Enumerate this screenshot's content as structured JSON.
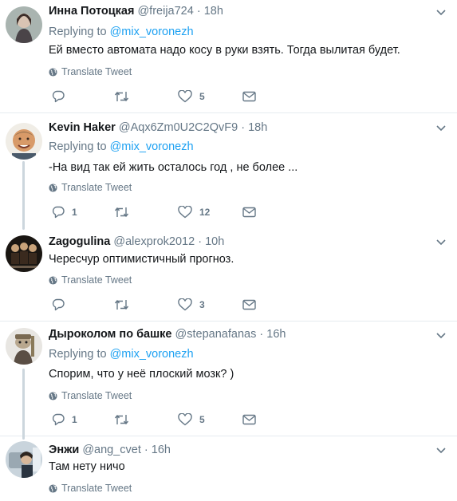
{
  "translate_label": "Translate Tweet",
  "replying_prefix": "Replying to",
  "colors": {
    "link": "#1da1f2",
    "muted": "#657786",
    "text": "#14171a",
    "divider": "#e6ecf0",
    "thread": "#ccd6dd"
  },
  "icons": {
    "reply": "reply-icon",
    "retweet": "retweet-icon",
    "like": "heart-icon",
    "dm": "envelope-icon",
    "more": "chevron-down-icon",
    "translate": "globe-icon"
  },
  "tweets": [
    {
      "name": "Инна Потоцкая",
      "handle": "@freija724",
      "time": "18h",
      "reply_to": "@mix_voronezh",
      "text": "Ей вместо автомата надо косу в руки взять. Тогда вылитая будет.",
      "replies": "",
      "retweets": "",
      "likes": "5"
    },
    {
      "name": "Kevin Haker",
      "handle": "@Aqx6Zm0U2C2QvF9",
      "time": "18h",
      "reply_to": "@mix_voronezh",
      "text": "-На вид так ей жить осталось год , не более ...",
      "replies": "1",
      "retweets": "",
      "likes": "12"
    },
    {
      "name": "Zagogulina",
      "handle": "@alexprok2012",
      "time": "10h",
      "reply_to": "",
      "text": "Чересчур оптимистичный прогноз.",
      "replies": "",
      "retweets": "",
      "likes": "3"
    },
    {
      "name": "Дыроколом по башке",
      "handle": "@stepanafanas",
      "time": "16h",
      "reply_to": "@mix_voronezh",
      "text": "Спорим, что у неё плоский мозк? )",
      "replies": "1",
      "retweets": "",
      "likes": "5"
    },
    {
      "name": "Энжи",
      "handle": "@ang_cvet",
      "time": "16h",
      "reply_to": "",
      "text": "Там нету ничо",
      "replies": "",
      "retweets": "",
      "likes": ""
    }
  ]
}
